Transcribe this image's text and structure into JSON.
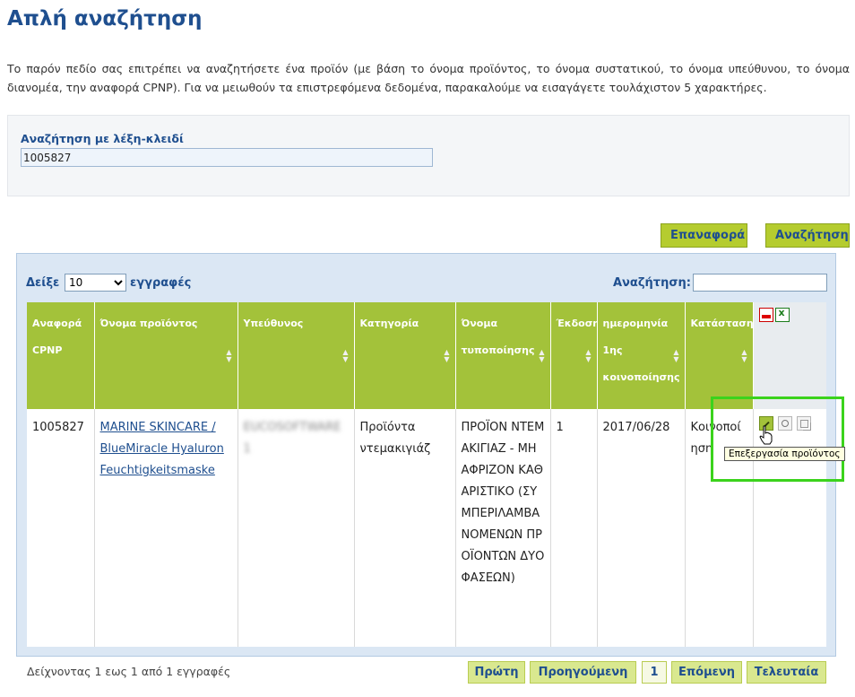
{
  "page": {
    "title": "Απλή αναζήτηση",
    "intro": "Το παρόν πεδίο σας επιτρέπει να αναζητήσετε ένα προϊόν (με βάση το όνομα προϊόντος, το όνομα συστατικού, το όνομα υπεύθυνου, το όνομα διανομέα, την αναφορά CPNP). Για να μειωθούν τα επιστρεφόμενα δεδομένα, παρακαλούμε να εισαγάγετε τουλάχιστον 5 χαρακτήρες."
  },
  "search": {
    "label": "Αναζήτηση με λέξη-κλειδί",
    "value": "1005827"
  },
  "buttons": {
    "reset": "Επαναφορά",
    "search": "Αναζήτηση"
  },
  "table_controls": {
    "show_prefix": "Δείξε",
    "page_size": "10",
    "page_size_options": [
      "10"
    ],
    "show_suffix": "εγγραφές",
    "filter_label": "Αναζήτηση:"
  },
  "columns": [
    "Αναφορά CPNP",
    "Όνομα προϊόντος",
    "Υπεύθυνος",
    "Κατηγορία",
    "Όνομα τυποποίησης",
    "Έκδοση",
    "ημερομηνία 1ης κοινοποίησης",
    "Κατάσταση"
  ],
  "header_icons": [
    "pdf-icon",
    "excel-icon"
  ],
  "rows": [
    {
      "cpnp": "1005827",
      "product_name": "MARINE SKINCARE / BlueMiracle Hyaluron Feuchtigkeitsmaske",
      "responsible": "EUCOSOFTWARE 1",
      "category": "Προϊόντα ντεμακιγιάζ",
      "frame_name": "ΠΡΟΪΟΝ ΝΤΕΜΑΚΙΓΙΑΖ - ΜΗ ΑΦΡΙΖΟΝ ΚΑΘΑΡΙΣΤΙΚΟ (ΣΥΜΠΕΡΙΛΑΜΒΑΝΟΜΕΝΩΝ ΠΡΟΪΟΝΤΩΝ ΔΥΟ ΦΑΣΕΩΝ)",
      "version": "1",
      "first_notification_date": "2017/06/28",
      "status": "Κοινοποίηση",
      "actions": [
        "edit-icon",
        "view-icon",
        "copy-icon"
      ]
    }
  ],
  "tooltip": "Επεξεργασία προϊόντος",
  "footer": {
    "info": "Δείχνοντας 1 εως 1 από 1 εγγραφές",
    "first": "Πρώτη",
    "previous": "Προηγούμενη",
    "current_page": "1",
    "next": "Επόμενη",
    "last": "Τελευταία"
  },
  "colors": {
    "brand_blue": "#1f4f8f",
    "header_green": "#a3c23a",
    "button_green": "#b5cc2f",
    "highlight": "#3bd31c"
  }
}
